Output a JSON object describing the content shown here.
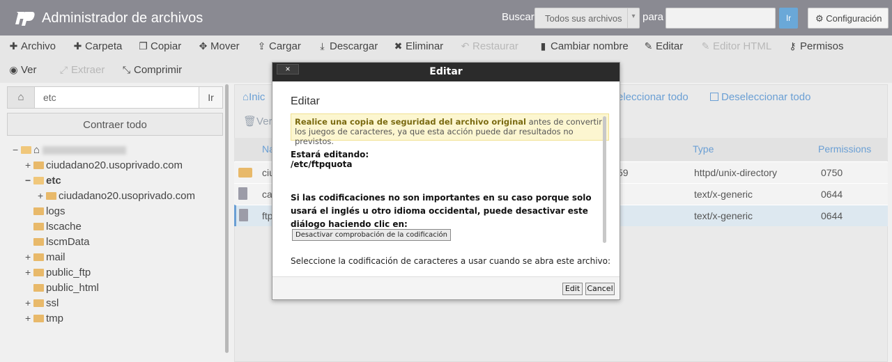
{
  "header": {
    "title": "Administrador de archivos",
    "search_label": "Buscar",
    "search_scope": "Todos sus archivos",
    "para_label": "para",
    "search_value": "",
    "go_label": "Ir",
    "config_label": "Configuración"
  },
  "toolbar": {
    "row1": [
      {
        "label": "Archivo",
        "icon": "plus",
        "disabled": false
      },
      {
        "label": "Carpeta",
        "icon": "plus",
        "disabled": false
      },
      {
        "label": "Copiar",
        "icon": "copy",
        "disabled": false
      },
      {
        "label": "Mover",
        "icon": "move",
        "disabled": false
      },
      {
        "label": "Cargar",
        "icon": "upload",
        "disabled": false
      },
      {
        "label": "Descargar",
        "icon": "download",
        "disabled": false
      },
      {
        "label": "Eliminar",
        "icon": "times",
        "disabled": false
      },
      {
        "label": "Restaurar",
        "icon": "undo",
        "disabled": true
      },
      {
        "label": "Cambiar nombre",
        "icon": "file",
        "disabled": false
      },
      {
        "label": "Editar",
        "icon": "pencil",
        "disabled": false
      },
      {
        "label": "Editor HTML",
        "icon": "edit",
        "disabled": true
      },
      {
        "label": "Permisos",
        "icon": "key",
        "disabled": false
      }
    ],
    "row2": [
      {
        "label": "Ver",
        "icon": "eye",
        "disabled": false
      },
      {
        "label": "Extraer",
        "icon": "expand",
        "disabled": true
      },
      {
        "label": "Comprimir",
        "icon": "compress",
        "disabled": false
      }
    ]
  },
  "left": {
    "path_value": "etc",
    "go_label": "Ir",
    "collapse_label": "Contraer todo",
    "tree": [
      {
        "label": "",
        "level": 0,
        "expander": "−",
        "blurred": true
      },
      {
        "label": "ciudadano20.usoprivado.com",
        "level": 1,
        "expander": "+"
      },
      {
        "label": "etc",
        "level": 1,
        "expander": "−",
        "bold": true
      },
      {
        "label": "ciudadano20.usoprivado.com",
        "level": 2,
        "expander": "+"
      },
      {
        "label": "logs",
        "level": 1,
        "expander": ""
      },
      {
        "label": "lscache",
        "level": 1,
        "expander": ""
      },
      {
        "label": "lscmData",
        "level": 1,
        "expander": ""
      },
      {
        "label": "mail",
        "level": 1,
        "expander": "+"
      },
      {
        "label": "public_ftp",
        "level": 1,
        "expander": "+"
      },
      {
        "label": "public_html",
        "level": 1,
        "expander": ""
      },
      {
        "label": "ssl",
        "level": 1,
        "expander": "+"
      },
      {
        "label": "tmp",
        "level": 1,
        "expander": "+"
      }
    ]
  },
  "right": {
    "home_label": "Inic",
    "select_all": "eleccionar todo",
    "deselect_all": "Deseleccionar todo",
    "view_trash": "Ver",
    "columns": {
      "name": "Na",
      "type": "Type",
      "permissions": "Permissions"
    },
    "rows": [
      {
        "name": "ciu",
        "date": "59",
        "type": "httpd/unix-directory",
        "perms": "0750",
        "kind": "folder"
      },
      {
        "name": "ca",
        "date": "",
        "type": "text/x-generic",
        "perms": "0644",
        "kind": "file"
      },
      {
        "name": "ftp",
        "date": "",
        "type": "text/x-generic",
        "perms": "0644",
        "kind": "file"
      }
    ]
  },
  "dialog": {
    "title": "Editar",
    "close": "×",
    "heading": "Editar",
    "warning_bold": "Realice una copia de seguridad del archivo original",
    "warning_rest": " antes de convertir los juegos de caracteres, ya que esta acción puede dar resultados no previstos.",
    "editing_label": "Estará editando:",
    "editing_path": "/etc/ftpquota",
    "info_text": "Si las codificaciones no son importantes en su caso porque solo usará el inglés u otro idioma occidental, puede desactivar este diálogo haciendo clic en:",
    "disable_button": "Desactivar comprobación de la codificación",
    "select_text": "Seleccione la codificación de caracteres a usar cuando se abra este archivo:",
    "edit_button": "Edit",
    "cancel_button": "Cancel"
  }
}
